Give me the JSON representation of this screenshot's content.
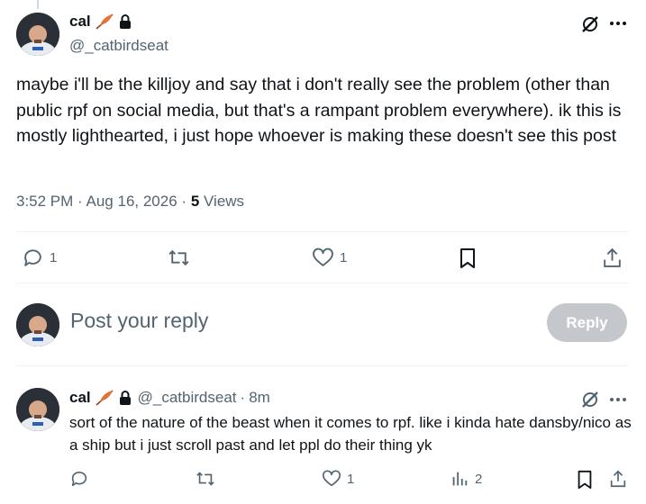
{
  "tweet": {
    "display_name": "cal",
    "handle": "@_catbirdseat",
    "text": "maybe i'll be the killjoy and say that i don't really see the problem (other than public rpf on social media, but that's a rampant problem everywhere). ik this is mostly lighthearted, i just hope whoever is making these doesn't see this post",
    "time": "3:52 PM",
    "date": "Aug 16, 2026",
    "views_count": "5",
    "views_label": "Views",
    "replies_count": "1",
    "likes_count": "1"
  },
  "composer": {
    "placeholder": "Post your reply",
    "button_label": "Reply"
  },
  "reply": {
    "display_name": "cal",
    "handle": "@_catbirdseat",
    "age": "8m",
    "text": "sort of the nature of the beast when it comes to rpf. like i kinda hate dansby/nico as a ship but i just scroll past and let ppl do their thing yk",
    "likes_count": "1",
    "views_count": "2"
  },
  "separators": {
    "dot": "·"
  },
  "colors": {
    "muted": "#536471",
    "text": "#0f1419",
    "divider": "#eff3f4",
    "reply_button": "#c4c8cc"
  }
}
